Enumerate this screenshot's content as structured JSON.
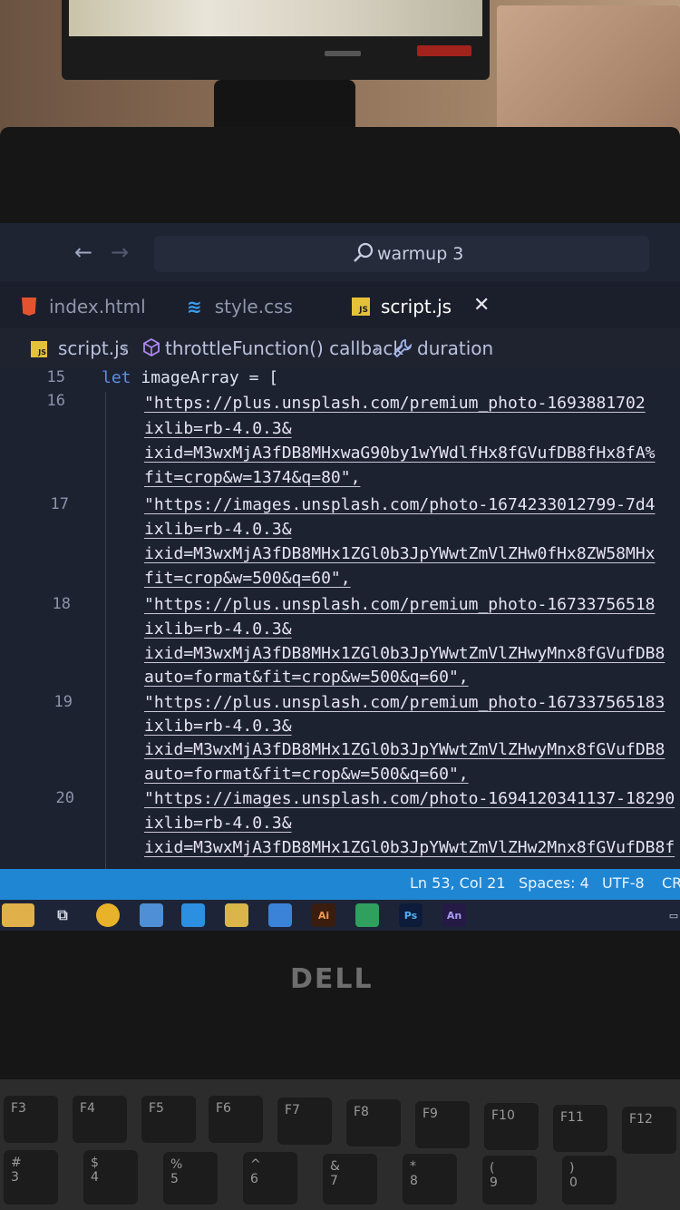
{
  "titlebar": {
    "search_text": "warmup 3"
  },
  "tabs": [
    {
      "label": "index.html",
      "icon": "html-file-icon"
    },
    {
      "label": "style.css",
      "icon": "css-file-icon"
    },
    {
      "label": "script.js",
      "icon": "js-file-icon",
      "active": true
    }
  ],
  "breadcrumb": {
    "file": "script.js",
    "function": "throttleFunction() callback",
    "item": "duration",
    "js_badge": "JS"
  },
  "code": {
    "line_numbers": [
      "15",
      "16",
      "17",
      "18",
      "19",
      "20"
    ],
    "line15": {
      "keyword": "let",
      "name": "imageArray",
      "rest": " = ["
    },
    "lines": [
      "\"https://plus.unsplash.com/premium_photo-1693881702",
      "ixlib=rb-4.0.3&",
      "ixid=M3wxMjA3fDB8MHxwaG90by1wYWdlfHx8fGVufDB8fHx8fA%",
      "fit=crop&w=1374&q=80\",",
      "\"https://images.unsplash.com/photo-1674233012799-7d4",
      "ixlib=rb-4.0.3&",
      "ixid=M3wxMjA3fDB8MHx1ZGl0b3JpYWwtZmVlZHw0fHx8ZW58MHx",
      "fit=crop&w=500&q=60\",",
      "\"https://plus.unsplash.com/premium_photo-16733756518",
      "ixlib=rb-4.0.3&",
      "ixid=M3wxMjA3fDB8MHx1ZGl0b3JpYWwtZmVlZHwyMnx8fGVufDB8",
      "auto=format&fit=crop&w=500&q=60\",",
      "\"https://plus.unsplash.com/premium_photo-167337565183",
      "ixlib=rb-4.0.3&",
      "ixid=M3wxMjA3fDB8MHx1ZGl0b3JpYWwtZmVlZHwyMnx8fGVufDB8",
      "auto=format&fit=crop&w=500&q=60\",",
      "\"https://images.unsplash.com/photo-1694120341137-18290",
      "ixlib=rb-4.0.3&",
      "ixid=M3wxMjA3fDB8MHx1ZGl0b3JpYWwtZmVlZHw2Mnx8fGVufDB8f"
    ]
  },
  "statusbar": {
    "position": "Ln 53, Col 21",
    "spaces": "Spaces: 4",
    "encoding": "UTF-8",
    "eol": "CR"
  },
  "taskbar": {
    "illustrator": "Ai",
    "photoshop": "Ps",
    "animate": "An"
  },
  "device": {
    "brand": "DELL"
  },
  "keyboard": {
    "function_keys": [
      "F3",
      "F4",
      "F5",
      "F6",
      "F7",
      "F8",
      "F9",
      "F10",
      "F11",
      "F12"
    ],
    "number_keys": [
      "#",
      "$",
      "%",
      "^",
      "&",
      "*",
      "(",
      ")"
    ],
    "number_keys_lower": [
      "3",
      "4",
      "5",
      "6",
      "7",
      "8",
      "9",
      "0"
    ]
  },
  "colors": {
    "editor_bg": "#1d2231",
    "statusbar": "#1f86d4",
    "keyword": "#5d8fe6"
  }
}
